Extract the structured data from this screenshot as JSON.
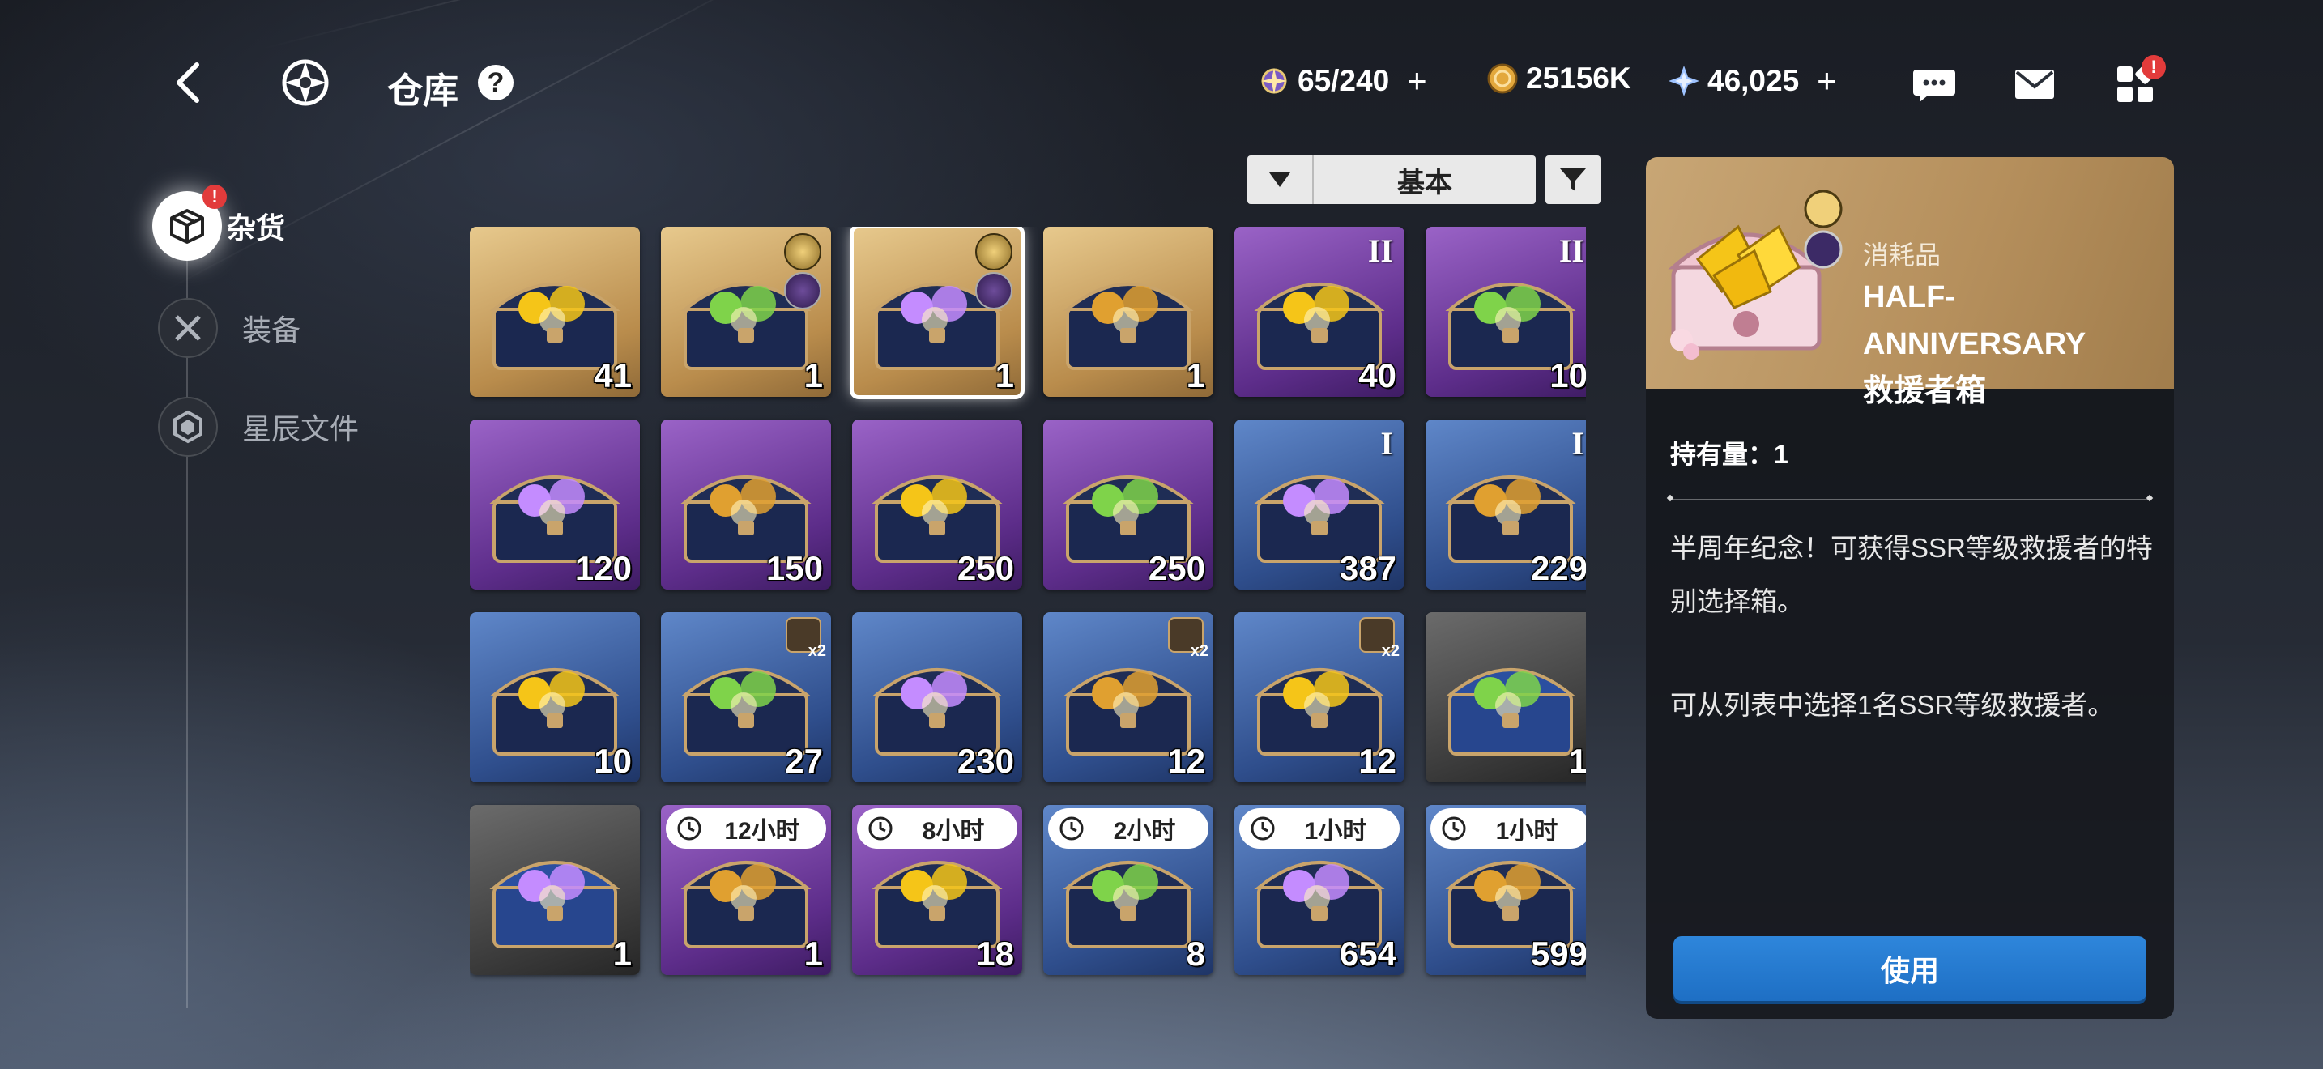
{
  "header": {
    "title": "仓库",
    "help": "?",
    "resources": [
      {
        "name": "stamina",
        "value": "65/240",
        "plus": "+"
      },
      {
        "name": "gold",
        "value": "25156K",
        "plus": ""
      },
      {
        "name": "crystal",
        "value": "46,025",
        "plus": "+"
      }
    ],
    "badge": "!"
  },
  "nav": {
    "badge": "!",
    "items": [
      {
        "label": "杂货",
        "active": true
      },
      {
        "label": "装备",
        "active": false
      },
      {
        "label": "星辰文件",
        "active": false
      }
    ]
  },
  "sort": {
    "label": "基本",
    "order_icon": "triangle-down-icon"
  },
  "items": [
    {
      "count": "41",
      "bg": "gold"
    },
    {
      "count": "1",
      "bg": "gold"
    },
    {
      "count": "1",
      "bg": "gold",
      "selected": true
    },
    {
      "count": "1",
      "bg": "gold"
    },
    {
      "count": "40",
      "bg": "purple",
      "tier": "II"
    },
    {
      "count": "10",
      "bg": "purple",
      "tier": "II"
    },
    {
      "count": "120",
      "bg": "purple"
    },
    {
      "count": "150",
      "bg": "purple"
    },
    {
      "count": "250",
      "bg": "purple"
    },
    {
      "count": "250",
      "bg": "purple"
    },
    {
      "count": "387",
      "bg": "blue",
      "tier": "I"
    },
    {
      "count": "229",
      "bg": "blue",
      "tier": "I"
    },
    {
      "count": "10",
      "bg": "blue"
    },
    {
      "count": "27",
      "bg": "blue",
      "tag": "x2"
    },
    {
      "count": "230",
      "bg": "blue"
    },
    {
      "count": "12",
      "bg": "blue",
      "tag": "x2"
    },
    {
      "count": "12",
      "bg": "blue",
      "tag": "x2"
    },
    {
      "count": "1",
      "bg": "gray"
    },
    {
      "count": "1",
      "bg": "gray"
    },
    {
      "count": "1",
      "bg": "purple",
      "timer": "12小时"
    },
    {
      "count": "18",
      "bg": "purple",
      "timer": "8小时"
    },
    {
      "count": "8",
      "bg": "blue",
      "timer": "2小时"
    },
    {
      "count": "654",
      "bg": "blue",
      "timer": "1小时"
    },
    {
      "count": "599",
      "bg": "blue",
      "timer": "1小时"
    }
  ],
  "detail": {
    "category": "消耗品",
    "name_line1": "HALF-ANNIVERSARY",
    "name_line2": "救援者箱",
    "owned": "持有量：1",
    "desc1": "半周年纪念！可获得SSR等级救援者的特别选择箱。",
    "desc2": "可从列表中选择1名SSR等级救援者。",
    "use_label": "使用"
  },
  "colors": {
    "accent_blue": "#2e86db",
    "badge_red": "#e23b3b"
  }
}
